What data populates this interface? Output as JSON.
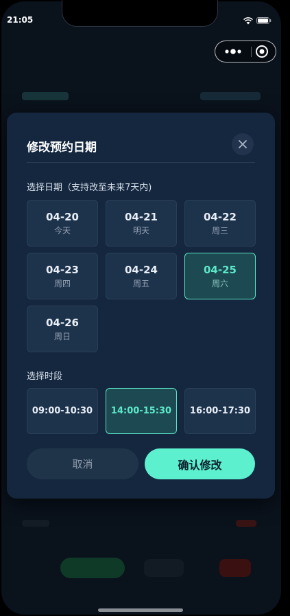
{
  "status_bar": {
    "time": "21:05"
  },
  "modal": {
    "title": "修改预约日期",
    "date_section_label": "选择日期（支持改至未来7天内)",
    "slot_section_label": "选择时段",
    "dates": [
      {
        "date": "04-20",
        "weekday": "今天",
        "selected": false
      },
      {
        "date": "04-21",
        "weekday": "明天",
        "selected": false
      },
      {
        "date": "04-22",
        "weekday": "周三",
        "selected": false
      },
      {
        "date": "04-23",
        "weekday": "周四",
        "selected": false
      },
      {
        "date": "04-24",
        "weekday": "周五",
        "selected": false
      },
      {
        "date": "04-25",
        "weekday": "周六",
        "selected": true
      },
      {
        "date": "04-26",
        "weekday": "周日",
        "selected": false
      }
    ],
    "slots": [
      {
        "label": "09:00-10:30",
        "selected": false
      },
      {
        "label": "14:00-15:30",
        "selected": true
      },
      {
        "label": "16:00-17:30",
        "selected": false
      }
    ],
    "cancel_label": "取消",
    "confirm_label": "确认修改"
  },
  "icons": {
    "close": "close-icon",
    "wifi": "wifi-icon",
    "battery": "battery-icon",
    "more": "more-icon",
    "target": "target-icon"
  },
  "colors": {
    "accent": "#5cf0cf",
    "modal_bg": "#14273f",
    "card_bg": "#1d324b",
    "selected_bg": "#1d4a52"
  }
}
